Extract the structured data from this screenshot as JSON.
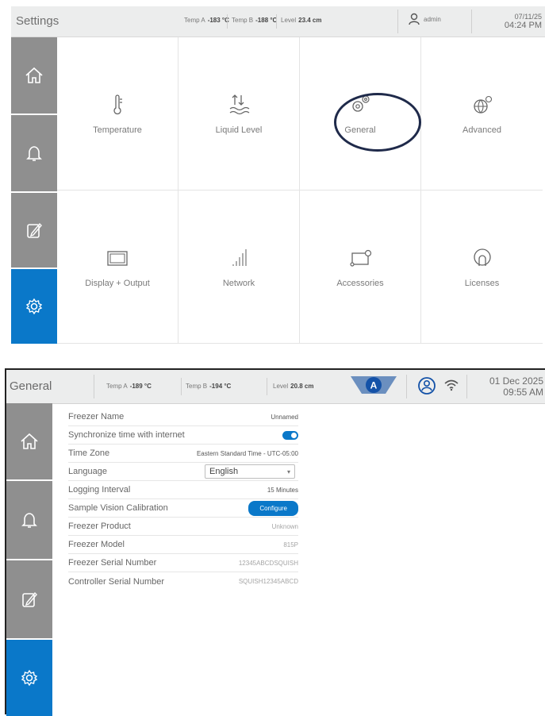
{
  "panel1": {
    "title": "Settings",
    "temp_a_label": "Temp A",
    "temp_a_value": "-183 °C",
    "temp_b_label": "Temp B",
    "temp_b_value": "-188 °C",
    "level_label": "Level",
    "level_value": "23.4 cm",
    "user": "admin",
    "date": "07/11/25",
    "time": "04:24 PM",
    "tiles": [
      {
        "label": "Temperature",
        "icon": "thermometer-icon"
      },
      {
        "label": "Liquid Level",
        "icon": "liquid-level-icon"
      },
      {
        "label": "General",
        "icon": "gears-icon"
      },
      {
        "label": "Advanced",
        "icon": "globe-gear-icon"
      },
      {
        "label": "Display + Output",
        "icon": "monitor-icon"
      },
      {
        "label": "Network",
        "icon": "signal-bars-icon"
      },
      {
        "label": "Accessories",
        "icon": "accessories-icon"
      },
      {
        "label": "Licenses",
        "icon": "license-icon"
      }
    ],
    "sidebar": [
      "home-icon",
      "bell-icon",
      "edit-icon",
      "settings-icon"
    ]
  },
  "panel2": {
    "title": "General",
    "temp_a_label": "Temp A",
    "temp_a_value": "-189 °C",
    "temp_b_label": "Temp B",
    "temp_b_value": "-194 °C",
    "level_label": "Level",
    "level_value": "20.8 cm",
    "badge_letter": "A",
    "date": "01 Dec 2025",
    "time": "09:55 AM",
    "rows": [
      {
        "label": "Freezer Name",
        "value": "Unnamed"
      },
      {
        "label": "Synchronize time with internet",
        "value": ""
      },
      {
        "label": "Time Zone",
        "value": "Eastern Standard Time - UTC-05:00"
      },
      {
        "label": "Language",
        "value": "English"
      },
      {
        "label": "Logging Interval",
        "value": "15 Minutes"
      },
      {
        "label": "Sample Vision Calibration",
        "value": "Configure"
      },
      {
        "label": "Freezer Product",
        "value": "Unknown"
      },
      {
        "label": "Freezer Model",
        "value": "815P"
      },
      {
        "label": "Freezer Serial Number",
        "value": "12345ABCDSQUISH"
      },
      {
        "label": "Controller Serial Number",
        "value": "SQUISH12345ABCD"
      }
    ],
    "sync_enabled": true
  },
  "colors": {
    "accent": "#0a78c9",
    "sidebar_gray": "#8f8f8f",
    "header_bg": "#eceded",
    "annotation_circle": "#1f2a4a"
  }
}
